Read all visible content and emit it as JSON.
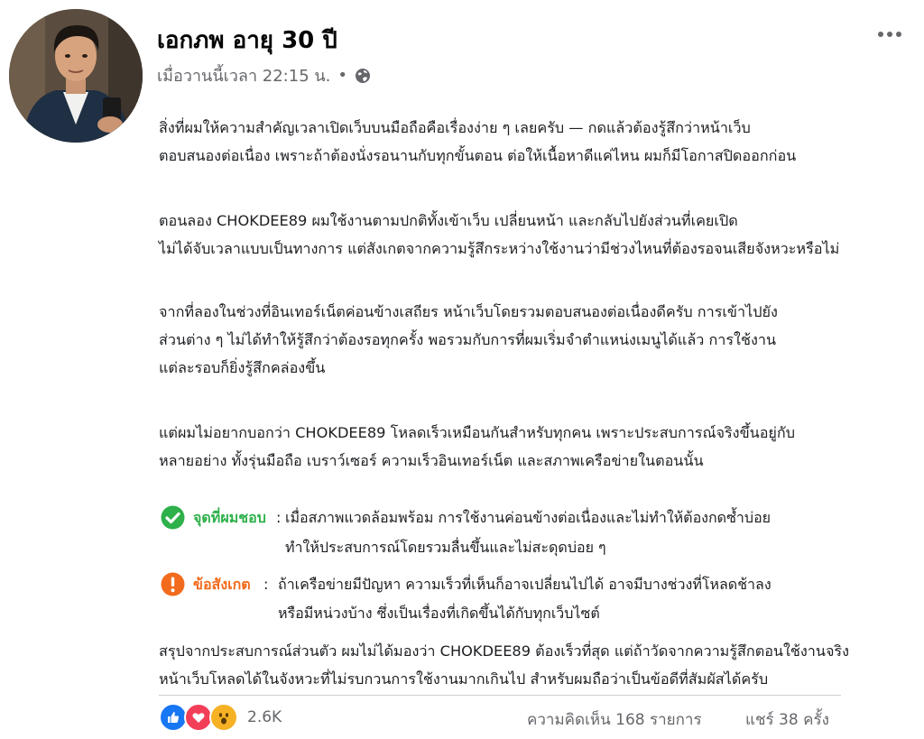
{
  "post": {
    "author": "เอกภพ อายุ 30 ปี",
    "timestamp": "เมื่อวานนี้เวลา 22:15 น.",
    "separator": "•",
    "privacy_icon": "globe-icon",
    "more_icon": "more-horizontal-icon",
    "paragraphs": [
      [
        "สิ่งที่ผมให้ความสำคัญเวลาเปิดเว็บบนมือถือคือเรื่องง่าย ๆ เลยครับ — กดแล้วต้องรู้สึกว่าหน้าเว็บ",
        "ตอบสนองต่อเนื่อง เพราะถ้าต้องนั่งรอนานกับทุกขั้นตอน ต่อให้เนื้อหาดีแค่ไหน ผมก็มีโอกาสปิดออกก่อน"
      ],
      [
        "ตอนลอง CHOKDEE89 ผมใช้งานตามปกติทั้งเข้าเว็บ เปลี่ยนหน้า และกลับไปยังส่วนที่เคยเปิด",
        "ไม่ได้จับเวลาแบบเป็นทางการ แต่สังเกตจากความรู้สึกระหว่างใช้งานว่ามีช่วงไหนที่ต้องรอจนเสียจังหวะหรือไม่"
      ],
      [
        "จากที่ลองในช่วงที่อินเทอร์เน็ตค่อนข้างเสถียร หน้าเว็บโดยรวมตอบสนองต่อเนื่องดีครับ การเข้าไปยัง",
        "ส่วนต่าง ๆ ไม่ได้ทำให้รู้สึกว่าต้องรอทุกครั้ง พอรวมกับการที่ผมเริ่มจำตำแหน่งเมนูได้แล้ว การใช้งาน",
        "แต่ละรอบก็ยิ่งรู้สึกคล่องขึ้น"
      ],
      [
        "แต่ผมไม่อยากบอกว่า CHOKDEE89 โหลดเร็วเหมือนกันสำหรับทุกคน เพราะประสบการณ์จริงขึ้นอยู่กับ",
        "หลายอย่าง ทั้งรุ่นมือถือ เบราว์เซอร์ ความเร็วอินเทอร์เน็ต และสภาพเครือข่ายในตอนนั้น"
      ]
    ],
    "pros": {
      "icon": "check-circle-icon",
      "label": "จุดที่ผมชอบ",
      "colon": ":",
      "line1": "เมื่อสภาพแวดล้อมพร้อม การใช้งานค่อนข้างต่อเนื่องและไม่ทำให้ต้องกดซ้ำบ่อย",
      "line2": "ทำให้ประสบการณ์โดยรวมลื่นขึ้นและไม่สะดุดบ่อย ๆ",
      "color": "#2eb04a"
    },
    "note": {
      "icon": "exclamation-circle-icon",
      "label": "ข้อสังเกต",
      "colon": ":",
      "line1": "ถ้าเครือข่ายมีปัญหา ความเร็วที่เห็นก็อาจเปลี่ยนไปได้ อาจมีบางช่วงที่โหลดช้าลง",
      "line2": "หรือมีหน่วงบ้าง ซึ่งเป็นเรื่องที่เกิดขึ้นได้กับทุกเว็บไซต์",
      "color": "#f26b1d"
    },
    "conclusion": [
      "สรุปจากประสบการณ์ส่วนตัว ผมไม่ได้มองว่า CHOKDEE89 ต้องเร็วที่สุด แต่ถ้าวัดจากความรู้สึกตอนใช้งานจริง",
      "หน้าเว็บโหลดได้ในจังหวะที่ไม่รบกวนการใช้งานมากเกินไป สำหรับผมถือว่าเป็นข้อดีที่สัมผัสได้ครับ"
    ]
  },
  "footer": {
    "reaction_icons": [
      "like-icon",
      "love-icon",
      "wow-icon"
    ],
    "reaction_count": "2.6K",
    "comments": "ความคิดเห็น 168 รายการ",
    "shares": "แชร์ 38 ครั้ง"
  },
  "colors": {
    "like": "#1877f2",
    "love": "#f33e58",
    "wow": "#f7b125",
    "secondary_text": "#65676b"
  }
}
